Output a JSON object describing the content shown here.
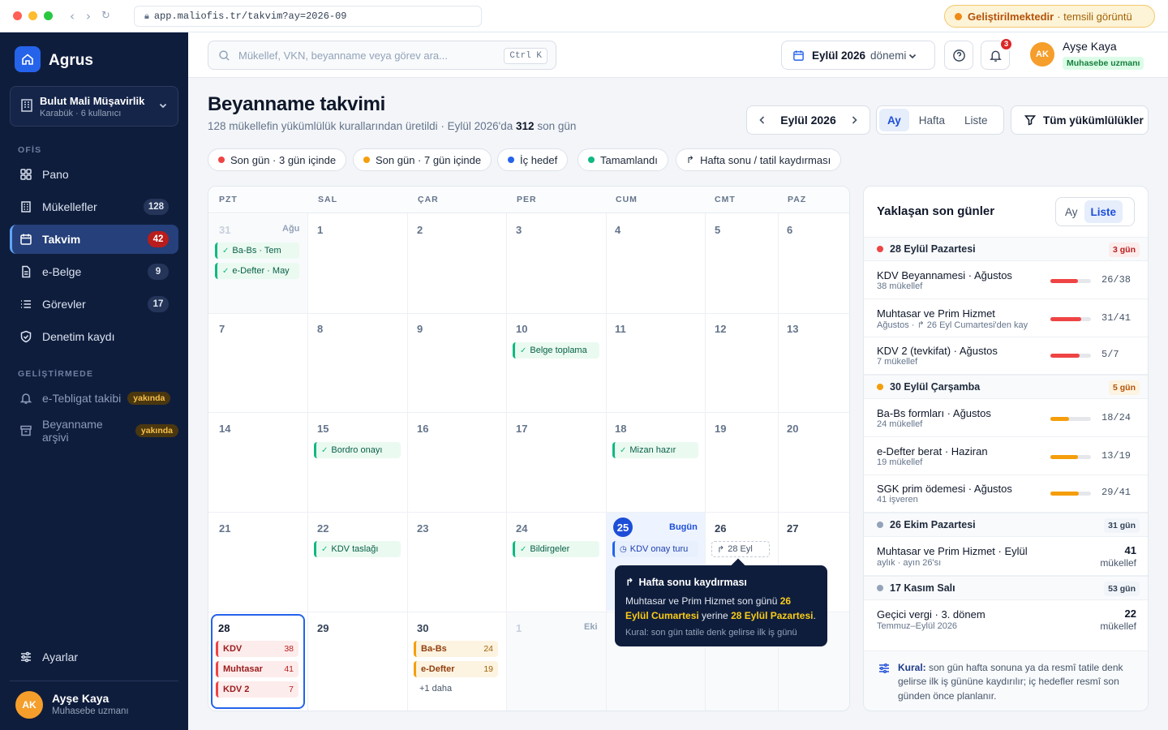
{
  "browser": {
    "url": "app.maliofis.tr/takvim?ay=2026-09",
    "dev_status": "Geliştirilmektedir",
    "dev_note": "· temsili görüntü"
  },
  "sidebar": {
    "brand": "Agrus",
    "org_name": "Bulut Mali Müşavirlik",
    "org_sub": "Karabük · 6 kullanıcı",
    "section_office": "OFİS",
    "section_dev": "GELİŞTİRMEDE",
    "items": [
      {
        "label": "Pano",
        "count": null,
        "icon": "grid-icon"
      },
      {
        "label": "Mükellefler",
        "count": "128",
        "icon": "building-icon"
      },
      {
        "label": "Takvim",
        "count": "42",
        "icon": "calendar-icon"
      },
      {
        "label": "e-Belge",
        "count": "9",
        "icon": "document-icon"
      },
      {
        "label": "Görevler",
        "count": "17",
        "icon": "list-icon"
      },
      {
        "label": "Denetim kaydı",
        "count": null,
        "icon": "shield-icon"
      }
    ],
    "dev_items": [
      {
        "label": "e-Tebligat takibi",
        "tag": "yakında",
        "icon": "bell-icon"
      },
      {
        "label": "Beyanname arşivi",
        "tag": "yakında",
        "icon": "archive-icon"
      }
    ],
    "settings": "Ayarlar",
    "user": {
      "initials": "AK",
      "name": "Ayşe Kaya",
      "role": "Muhasebe uzmanı"
    }
  },
  "topbar": {
    "search_placeholder": "Mükellef, VKN, beyanname veya görev ara...",
    "search_shortcut": "Ctrl K",
    "period_main": "Eylül 2026",
    "period_suffix": "dönemi",
    "notif_count": "3",
    "user": {
      "initials": "AK",
      "name": "Ayşe Kaya",
      "role": "Muhasebe uzmanı"
    }
  },
  "page": {
    "title": "Beyanname takvimi",
    "subtitle_a": "128 mükellefin yükümlülük kurallarından üretildi · Eylül 2026'da ",
    "subtitle_b": "312",
    "subtitle_c": " son gün",
    "month": "Eylül 2026",
    "view_tabs": [
      "Ay",
      "Hafta",
      "Liste"
    ],
    "filter": "Tüm yükümlülükler"
  },
  "legend": [
    {
      "label": "Son gün · 3 gün içinde",
      "color": "#ef4444"
    },
    {
      "label": "Son gün · 7 gün içinde",
      "color": "#f59e0b"
    },
    {
      "label": "İç hedef",
      "color": "#2563eb"
    },
    {
      "label": "Tamamlandı",
      "color": "#10b981"
    },
    {
      "label": "Hafta sonu / tatil kaydırması",
      "color": null
    }
  ],
  "calendar": {
    "weekdays": [
      "PZT",
      "SAL",
      "ÇAR",
      "PER",
      "CUM",
      "CMT",
      "PAZ"
    ],
    "prev_month_label": "Ağu",
    "next_month_label": "Eki",
    "today_label": "Bugün",
    "events": {
      "ba_bs_tem": "Ba-Bs · Tem",
      "edefter_may": "e-Defter · May",
      "belge_toplama": "Belge toplama",
      "bordro": "Bordro onayı",
      "mizan": "Mizan hazır",
      "kdv_taslak": "KDV taslağı",
      "bildirgeler": "Bildirgeler",
      "kdv_onay": "KDV onay turu",
      "shift": "28 Eyl",
      "d28": [
        {
          "label": "KDV",
          "count": "38"
        },
        {
          "label": "Muhtasar",
          "count": "41"
        },
        {
          "label": "KDV 2",
          "count": "7"
        }
      ],
      "d30": [
        {
          "label": "Ba-Bs",
          "count": "24"
        },
        {
          "label": "e-Defter",
          "count": "19"
        }
      ],
      "more": "+1 daha"
    },
    "tooltip": {
      "title": "Hafta sonu kaydırması",
      "t1": "Muhtasar ve Prim Hizmet son günü ",
      "h1": "26 Eylül Cumartesi",
      "t2": " yerine ",
      "h2": "28 Eylül Pazartesi",
      "t3": ".",
      "rule": "Kural: son gün tatile denk gelirse ilk iş günü"
    }
  },
  "upcoming": {
    "title": "Yaklaşan son günler",
    "tabs": [
      "Ay",
      "Liste"
    ],
    "groups": [
      {
        "date": "28 Eylül Pazartesi",
        "days": "3 gün",
        "color": "#ef4444"
      },
      {
        "date": "30 Eylül Çarşamba",
        "days": "5 gün",
        "color": "#f59e0b"
      },
      {
        "date": "26 Ekim Pazartesi",
        "days": "31 gün",
        "color": "#94a3b8"
      },
      {
        "date": "17 Kasım Salı",
        "days": "53 gün",
        "color": "#94a3b8"
      }
    ],
    "items": [
      {
        "title": "KDV Beyannamesi · Ağustos",
        "sub": "38 mükellef",
        "progress": "26/38",
        "fraction": 0.684,
        "color": "#ef4444"
      },
      {
        "title": "Muhtasar ve Prim Hizmet",
        "sub": "Ağustos · ↱ 26 Eyl Cumartesi'den kay",
        "progress": "31/41",
        "fraction": 0.756,
        "color": "#ef4444"
      },
      {
        "title": "KDV 2 (tevkifat) · Ağustos",
        "sub": "7 mükellef",
        "progress": "5/7",
        "fraction": 0.714,
        "color": "#ef4444"
      },
      {
        "title": "Ba-Bs formları · Ağustos",
        "sub": "24 mükellef",
        "progress": "18/24",
        "fraction": 0.45,
        "color": "#f59e0b"
      },
      {
        "title": "e-Defter berat · Haziran",
        "sub": "19 mükellef",
        "progress": "13/19",
        "fraction": 0.684,
        "color": "#f59e0b"
      },
      {
        "title": "SGK prim ödemesi · Ağustos",
        "sub": "41 işveren",
        "progress": "29/41",
        "fraction": 0.707,
        "color": "#f59e0b"
      },
      {
        "title": "Muhtasar ve Prim Hizmet · Eylül",
        "sub": "aylık · ayın 26'sı",
        "count": "41",
        "unit": "mükellef"
      },
      {
        "title": "Geçici vergi · 3. dönem",
        "sub": "Temmuz–Eylül 2026",
        "count": "22",
        "unit": "mükellef"
      }
    ],
    "rule_bold": "Kural:",
    "rule_text": " son gün hafta sonuna ya da resmî tatile denk gelirse ilk iş gününe kaydırılır; iç hedefler resmî son günden önce planlanır."
  },
  "colors": {
    "accent": "#2563eb",
    "sidebar": "#0f1d3d",
    "danger": "#ef4444",
    "warning": "#f59e0b",
    "success": "#10b981"
  }
}
